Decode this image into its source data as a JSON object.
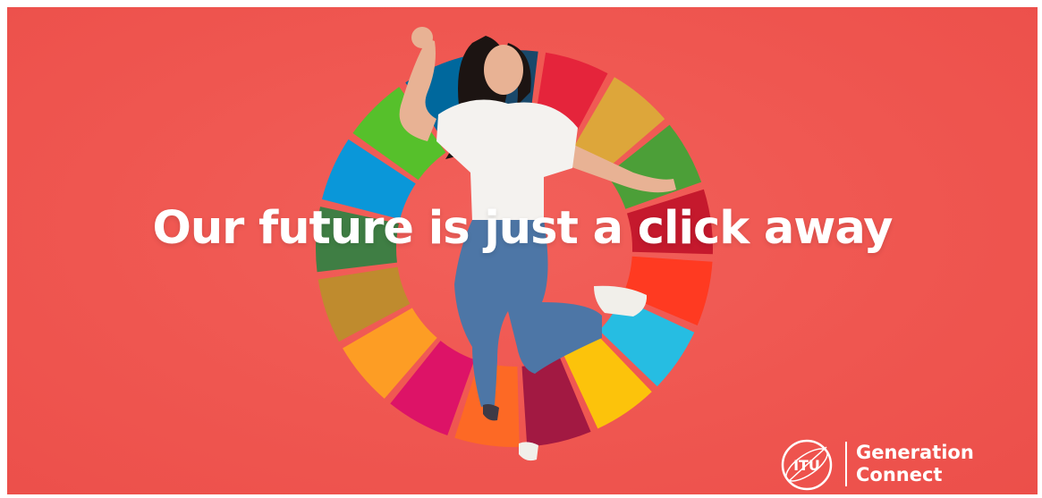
{
  "headline": "Our future is just a click away",
  "logo": {
    "emblem_text": "ITU",
    "line1": "Generation",
    "line2": "Connect"
  },
  "sdg_wheel": {
    "segment_colors": [
      "#E5243B",
      "#DDA63A",
      "#4C9F38",
      "#C5192D",
      "#FF3A21",
      "#26BDE2",
      "#FCC30B",
      "#A21942",
      "#FD6925",
      "#DD1367",
      "#FD9D24",
      "#BF8B2E",
      "#3F7E44",
      "#0A97D9",
      "#56C02B",
      "#00689D",
      "#19486A"
    ]
  },
  "colors": {
    "background": "#EF5650",
    "text": "#FFFFFF"
  }
}
